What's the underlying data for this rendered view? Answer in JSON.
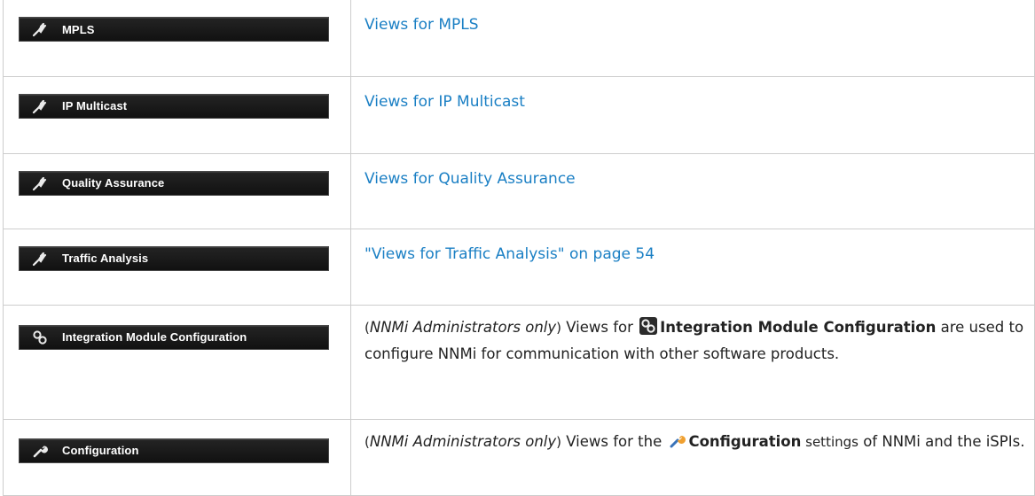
{
  "rows": [
    {
      "button_label": "MPLS",
      "button_icon": "plug-icon",
      "link_text": "Views for MPLS"
    },
    {
      "button_label": "IP Multicast",
      "button_icon": "plug-icon",
      "link_text": "Views for IP Multicast"
    },
    {
      "button_label": "Quality Assurance",
      "button_icon": "plug-icon",
      "link_text": "Views for Quality Assurance"
    },
    {
      "button_label": "Traffic Analysis",
      "button_icon": "plug-icon",
      "link_text": "\"Views for Traffic Analysis\" on page 54"
    },
    {
      "button_label": "Integration Module Configuration",
      "button_icon": "linked-gears-icon",
      "desc": {
        "open_paren": "(",
        "role": "NNMi Administrators only",
        "close_paren": ")",
        "before": " Views for ",
        "bold": "Integration Module Configuration",
        "after": " are used to configure NNMi for communication with other software products."
      }
    },
    {
      "button_label": "Configuration",
      "button_icon": "wrench-icon",
      "desc": {
        "open_paren": "(",
        "role": "NNMi Administrators only",
        "close_paren": ")",
        "before": " Views for the ",
        "bold": "Configuration",
        "after_1": " settings",
        "after_2": " of NNMi and the iSPIs."
      }
    }
  ],
  "colors": {
    "link": "#1a7fc4",
    "button_bg": "#1a1a1a",
    "button_text": "#ffffff",
    "border": "#cdcdcd"
  }
}
